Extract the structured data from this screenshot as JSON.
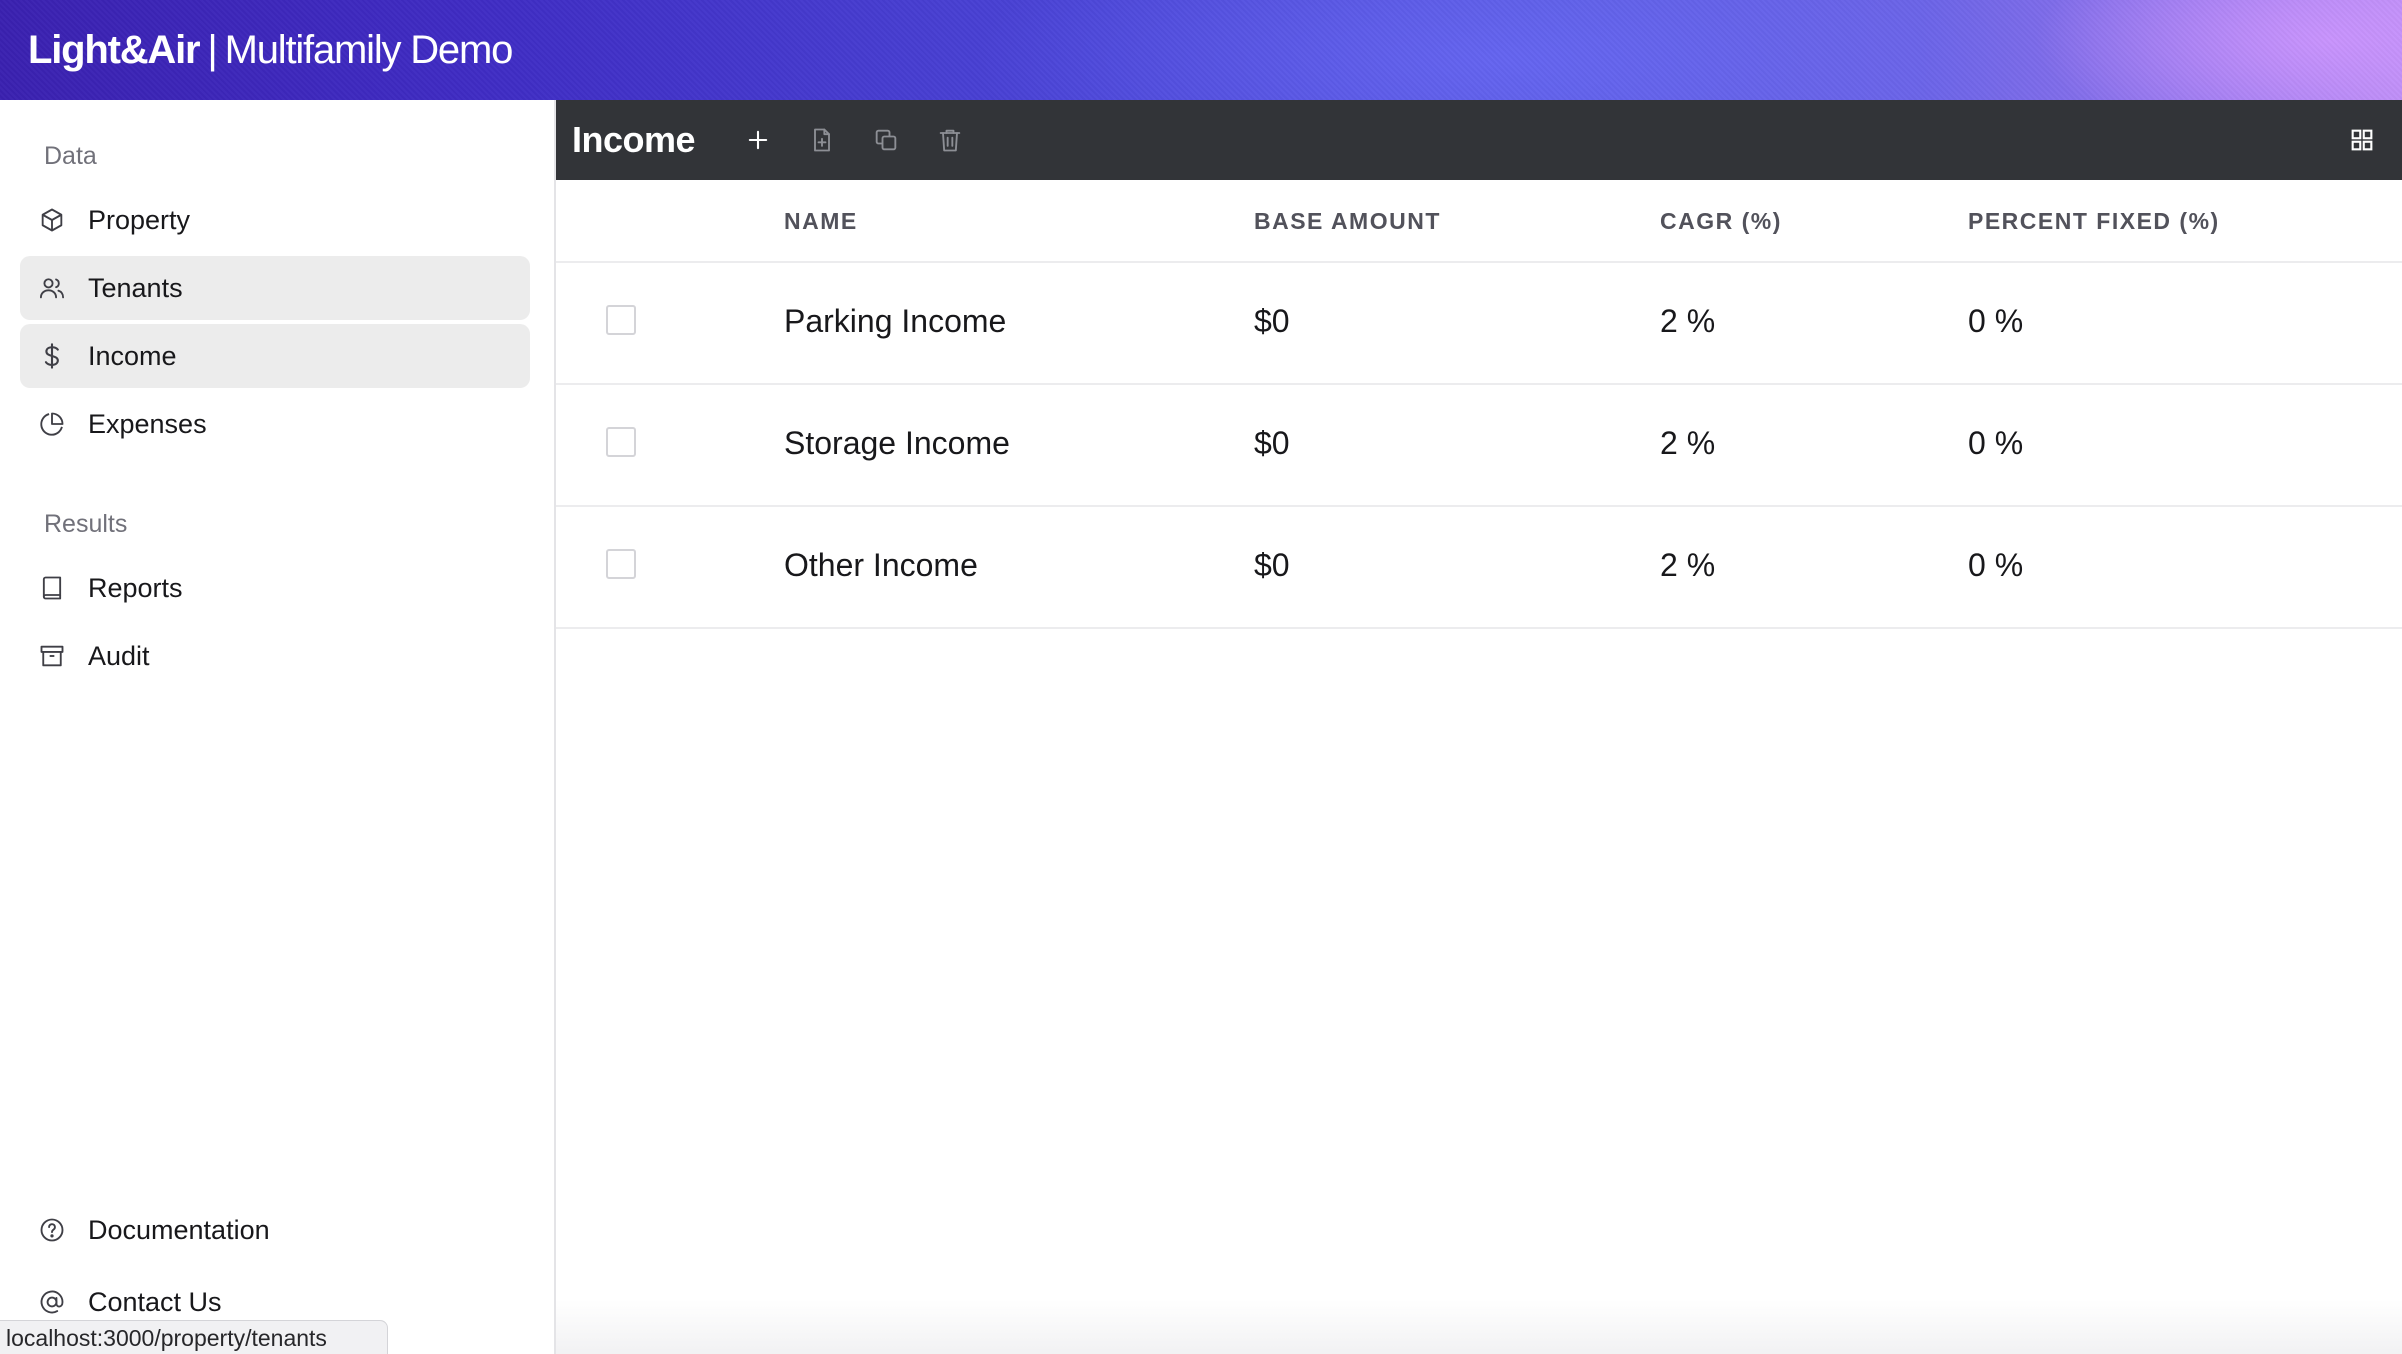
{
  "header": {
    "logo": "Light&Air",
    "separator": "|",
    "subtitle": "Multifamily Demo"
  },
  "sidebar": {
    "data_section": "Data",
    "data_items": [
      {
        "label": "Property",
        "icon": "cube-icon"
      },
      {
        "label": "Tenants",
        "icon": "users-icon"
      },
      {
        "label": "Income",
        "icon": "dollar-icon"
      },
      {
        "label": "Expenses",
        "icon": "pie-chart-icon"
      }
    ],
    "results_section": "Results",
    "results_items": [
      {
        "label": "Reports",
        "icon": "book-icon"
      },
      {
        "label": "Audit",
        "icon": "archive-icon"
      }
    ],
    "footer_items": [
      {
        "label": "Documentation",
        "icon": "help-circle-icon"
      },
      {
        "label": "Contact Us",
        "icon": "at-sign-icon"
      }
    ]
  },
  "status_bar": {
    "url": "localhost:3000/property/tenants"
  },
  "toolbar": {
    "title": "Income",
    "actions": [
      "plus-icon",
      "file-add-icon",
      "copy-icon",
      "trash-icon"
    ],
    "view_toggle": "grid-icon"
  },
  "table": {
    "columns": [
      "NAME",
      "BASE AMOUNT",
      "CAGR (%)",
      "PERCENT FIXED (%)"
    ],
    "rows": [
      {
        "name": "Parking Income",
        "base_amount": "$0",
        "cagr": "2 %",
        "percent_fixed": "0 %",
        "selected": false
      },
      {
        "name": "Storage Income",
        "base_amount": "$0",
        "cagr": "2 %",
        "percent_fixed": "0 %",
        "selected": false
      },
      {
        "name": "Other Income",
        "base_amount": "$0",
        "cagr": "2 %",
        "percent_fixed": "0 %",
        "selected": false
      }
    ]
  },
  "colors": {
    "toolbar_bg": "#323438",
    "hover_bg": "#ececec",
    "banner_start": "#3a21b0",
    "banner_end": "#b78bf3"
  }
}
